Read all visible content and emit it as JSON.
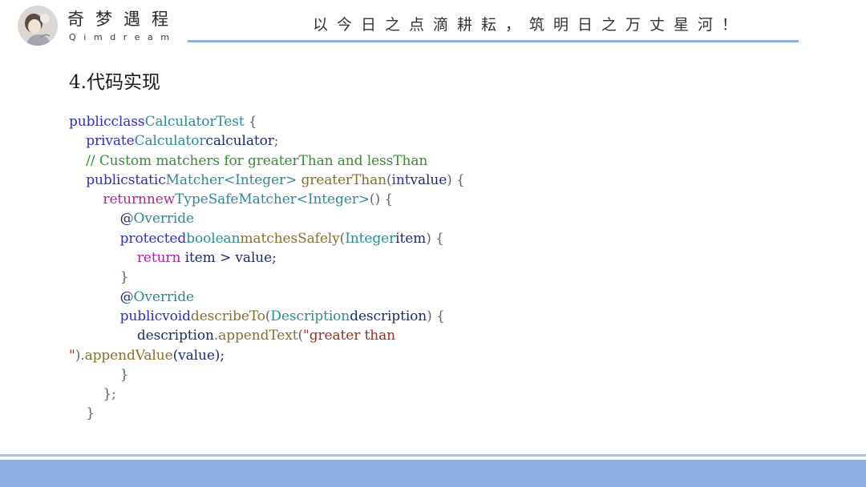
{
  "header": {
    "brand_title": "奇梦遇程",
    "brand_subtitle": "Qimdream",
    "slogan": "以今日之点滴耕耘，筑明日之万丈星河！"
  },
  "section": {
    "title": "4.代码实现"
  },
  "code": {
    "lines": [
      [
        {
          "t": "public",
          "c": "kw"
        },
        {
          "t": "class",
          "c": "kw"
        },
        {
          "t": "CalculatorTest",
          "c": "ty"
        },
        {
          "t": " {",
          "c": "pn"
        }
      ],
      [
        {
          "t": "    private",
          "c": "kw"
        },
        {
          "t": "Calculator",
          "c": "ty"
        },
        {
          "t": "calculator",
          "c": "id"
        },
        {
          "t": ";",
          "c": "pn"
        }
      ],
      [
        {
          "t": "    // Custom matchers for greaterThan and lessThan",
          "c": "cm"
        }
      ],
      [
        {
          "t": "    public",
          "c": "kw"
        },
        {
          "t": "static",
          "c": "kw"
        },
        {
          "t": "Matcher",
          "c": "ty"
        },
        {
          "t": "<Integer>",
          "c": "ty"
        },
        {
          "t": " ",
          "c": "pn"
        },
        {
          "t": "greaterThan",
          "c": "fn"
        },
        {
          "t": "(",
          "c": "pn"
        },
        {
          "t": "int",
          "c": "kw"
        },
        {
          "t": "value",
          "c": "id"
        },
        {
          "t": ") {",
          "c": "pn"
        }
      ],
      [
        {
          "t": "        return",
          "c": "rt"
        },
        {
          "t": "new",
          "c": "rt"
        },
        {
          "t": "TypeSafeMatcher",
          "c": "ty"
        },
        {
          "t": "<Integer>",
          "c": "ty"
        },
        {
          "t": "() {",
          "c": "pn"
        }
      ],
      [
        {
          "t": "            @",
          "c": "id"
        },
        {
          "t": "Override",
          "c": "ty"
        }
      ],
      [
        {
          "t": "            protected",
          "c": "kw"
        },
        {
          "t": "boolean",
          "c": "ty"
        },
        {
          "t": "matchesSafely",
          "c": "fn"
        },
        {
          "t": "(",
          "c": "pn"
        },
        {
          "t": "Integer",
          "c": "ty"
        },
        {
          "t": "item",
          "c": "id"
        },
        {
          "t": ") {",
          "c": "pn"
        }
      ],
      [
        {
          "t": "                return",
          "c": "rt"
        },
        {
          "t": " item > value;",
          "c": "id"
        }
      ],
      [
        {
          "t": "            }",
          "c": "pn"
        }
      ],
      [
        {
          "t": "            @",
          "c": "id"
        },
        {
          "t": "Override",
          "c": "ty"
        }
      ],
      [
        {
          "t": "            public",
          "c": "kw"
        },
        {
          "t": "void",
          "c": "kw"
        },
        {
          "t": "describeTo",
          "c": "fn"
        },
        {
          "t": "(",
          "c": "pn"
        },
        {
          "t": "Description",
          "c": "ty"
        },
        {
          "t": "description",
          "c": "id"
        },
        {
          "t": ") {",
          "c": "pn"
        }
      ],
      [
        {
          "t": "                description",
          "c": "id"
        },
        {
          "t": ".",
          "c": "pn"
        },
        {
          "t": "appendText",
          "c": "fn"
        },
        {
          "t": "(",
          "c": "pn"
        },
        {
          "t": "\"greater than",
          "c": "st"
        }
      ],
      [
        {
          "t": "\"",
          "c": "st"
        },
        {
          "t": ").",
          "c": "pn"
        },
        {
          "t": "appendValue",
          "c": "fn"
        },
        {
          "t": "(value);",
          "c": "id"
        }
      ],
      [
        {
          "t": "            }",
          "c": "pn"
        }
      ],
      [
        {
          "t": "        };",
          "c": "pn"
        }
      ],
      [
        {
          "t": "    }",
          "c": "pn"
        }
      ]
    ]
  },
  "colors": {
    "accent_rule": "#8aaede",
    "footer_bar": "#8eaee1",
    "keyword": "#2f2fb8",
    "type": "#2b8a96",
    "comment": "#3a8a3a",
    "return_keyword": "#b21fa0",
    "method": "#8b6d2c",
    "string": "#a12d1f"
  }
}
